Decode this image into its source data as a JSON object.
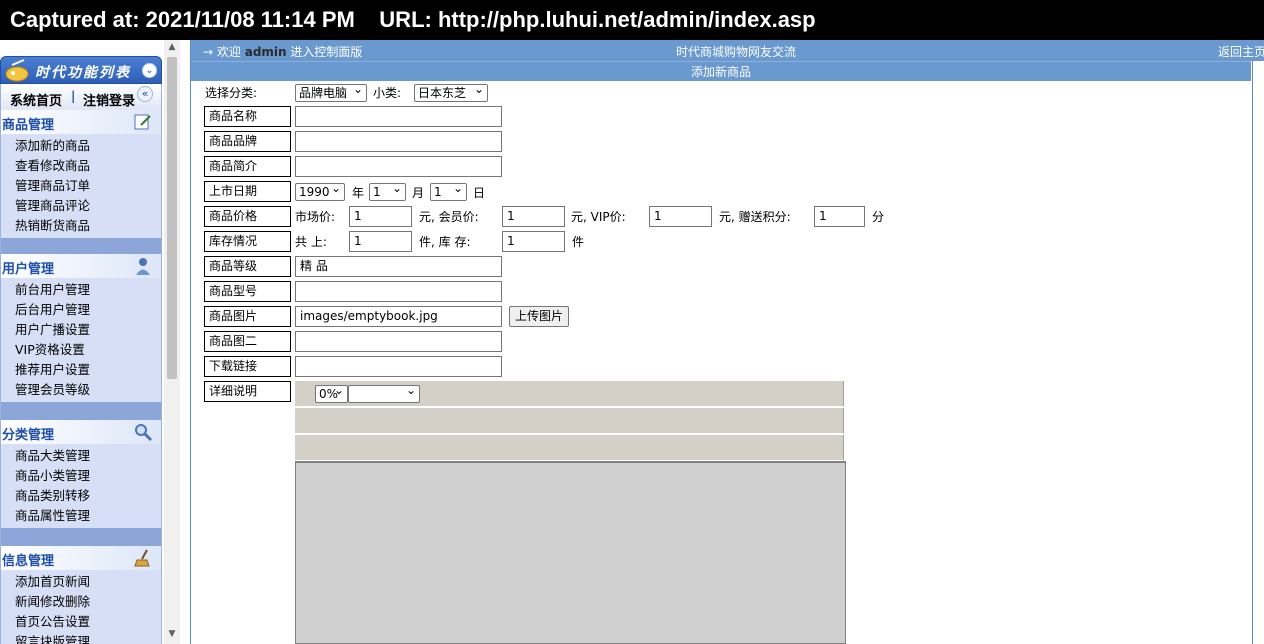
{
  "banner": {
    "text": "Captured at: 2021/11/08 11:14 PM    URL: http://php.luhui.net/admin/index.asp"
  },
  "sidebar": {
    "title": "时代功能列表",
    "home": "系统首页",
    "sep": "|",
    "logout": "注销登录",
    "groups": [
      {
        "title": "商品管理",
        "icon": "edit-icon",
        "items": [
          "添加新的商品",
          "查看修改商品",
          "管理商品订单",
          "管理商品评论",
          "热销断货商品"
        ]
      },
      {
        "title": "用户管理",
        "icon": "user-icon",
        "items": [
          "前台用户管理",
          "后台用户管理",
          "用户广播设置",
          "VIP资格设置",
          "推荐用户设置",
          "管理会员等级"
        ]
      },
      {
        "title": "分类管理",
        "icon": "search-icon",
        "items": [
          "商品大类管理",
          "商品小类管理",
          "商品类别转移",
          "商品属性管理"
        ]
      },
      {
        "title": "信息管理",
        "icon": "broom-icon",
        "items": [
          "添加首页新闻",
          "新闻修改删除",
          "首页公告设置",
          "留言块版管理"
        ]
      }
    ]
  },
  "topbar": {
    "arrow": "→",
    "welcome": "欢迎",
    "admin": "admin",
    "enter": "进入控制面版",
    "center": "时代商城购物网友交流",
    "right": "返回主页"
  },
  "form": {
    "heading": "添加新商品",
    "category_label": "选择分类:",
    "category_value": "品牌电脑",
    "subcategory_label": "小类:",
    "subcategory_value": "日本东芝",
    "name_label": "商品名称",
    "brand_label": "商品品牌",
    "intro_label": "商品简介",
    "date_label": "上市日期",
    "year_value": "1990",
    "year_unit": "年",
    "month_value": "1",
    "month_unit": "月",
    "day_value": "1",
    "day_unit": "日",
    "price_label": "商品价格",
    "market_price_label": "市场价:",
    "market_price": "1",
    "member_price_label": "元, 会员价:",
    "member_price": "1",
    "vip_price_label": "元, VIP价:",
    "vip_price": "1",
    "points_label": "元, 赠送积分:",
    "points": "1",
    "points_unit": "分",
    "stock_label": "库存情况",
    "shelf_label": "共 上:",
    "shelf_value": "1",
    "stock_qty_label": "件, 库 存:",
    "stock_value": "1",
    "stock_unit": "件",
    "grade_label": "商品等级",
    "grade_value": "精 品",
    "model_label": "商品型号",
    "image_label": "商品图片",
    "image_value": "images/emptybook.jpg",
    "upload_button": "上传图片",
    "image2_label": "商品图二",
    "download_label": "下载链接",
    "detail_label": "详细说明",
    "zoom_value": "0%"
  }
}
